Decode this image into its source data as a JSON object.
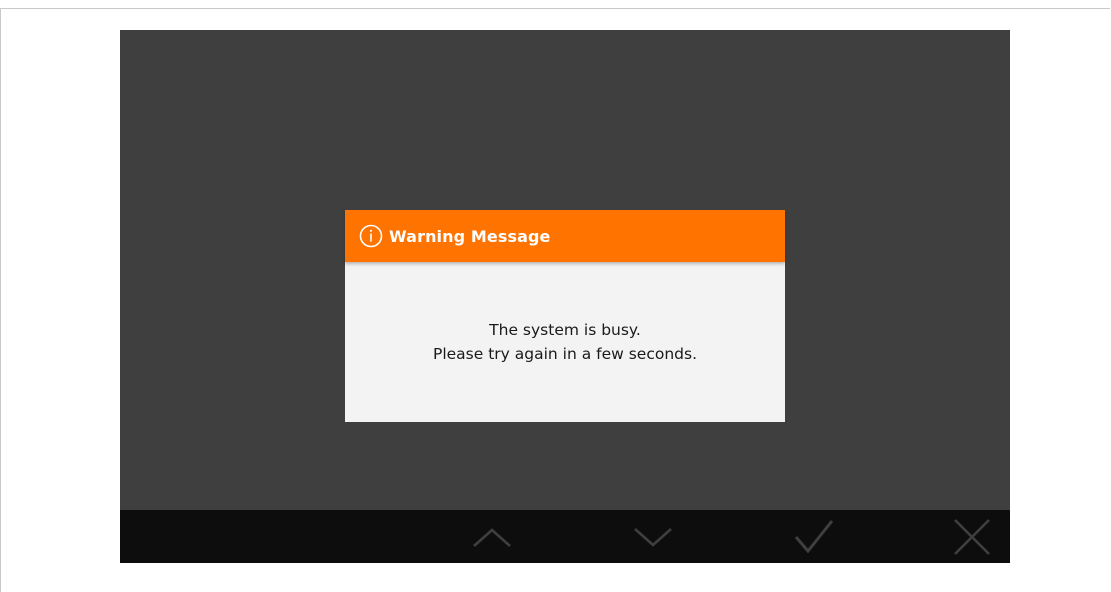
{
  "dialog": {
    "title": "Warning Message",
    "icon": "info-icon",
    "header_color": "#ff7300",
    "message_line1": "The system is busy.",
    "message_line2": "Please try again in a few seconds."
  },
  "bottom_bar": {
    "buttons": [
      {
        "name": "up",
        "icon": "chevron-up-icon"
      },
      {
        "name": "down",
        "icon": "chevron-down-icon"
      },
      {
        "name": "confirm",
        "icon": "checkmark-icon"
      },
      {
        "name": "cancel",
        "icon": "close-icon"
      }
    ]
  },
  "colors": {
    "screen_background": "#3f3f3f",
    "bar_background": "#0d0d0d",
    "icon_color": "#3f3f3f"
  }
}
